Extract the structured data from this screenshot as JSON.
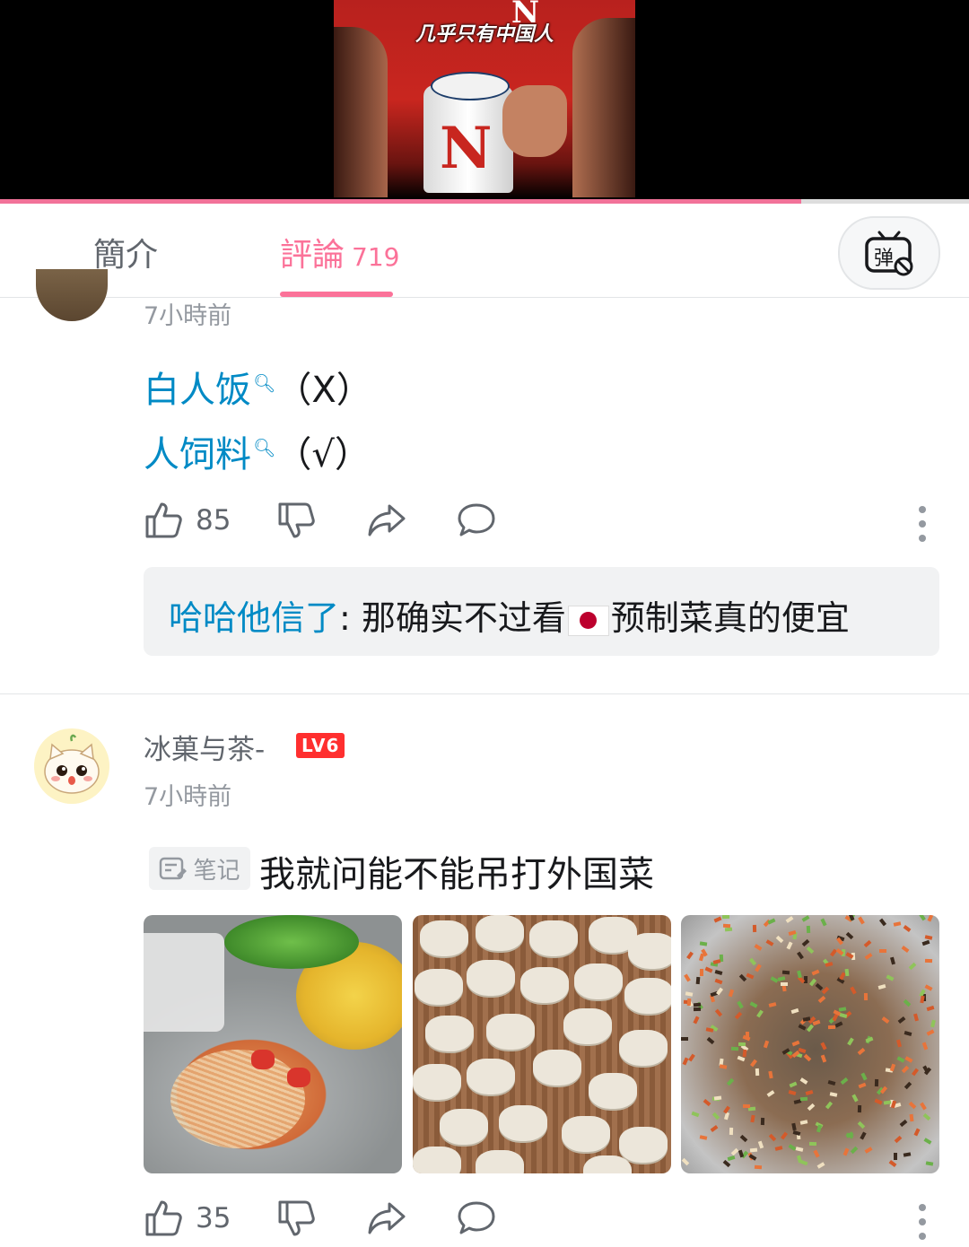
{
  "video": {
    "caption": "几乎只有中国人",
    "shirt_logo": "N",
    "mug_logo": "N",
    "progress": 0.827
  },
  "tabs": [
    {
      "label": "簡介",
      "count": ""
    },
    {
      "label": "評論",
      "count": "719"
    }
  ],
  "danmaku_button": {
    "icon": "danmaku-off-icon",
    "glyph": "弹"
  },
  "comments": [
    {
      "time": "7小時前",
      "lines": [
        {
          "keyword": "白人饭",
          "suffix": "（X）"
        },
        {
          "keyword": "人饲料",
          "suffix": "（√）"
        }
      ],
      "likes": "85",
      "reply": {
        "name": "哈哈他信了",
        "text_before": ": 那确实不过看",
        "text_after": "预制菜真的便宜",
        "flag": "japan-flag"
      }
    },
    {
      "username": "冰菓与茶-",
      "level": "LV6",
      "time": "7小時前",
      "note_badge": "笔记",
      "text": "我就问能不能吊打外国菜",
      "images": [
        "noodles-photo",
        "dumplings-photo",
        "filling-photo"
      ],
      "likes": "35"
    }
  ],
  "colors": {
    "accent": "#fb7299",
    "link": "#008ac5",
    "level": "#ff2f2f",
    "muted": "#9499a0"
  }
}
